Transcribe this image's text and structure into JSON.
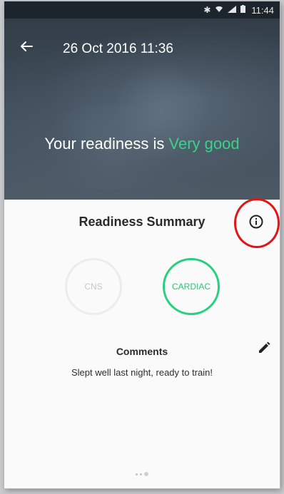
{
  "status_bar": {
    "time": "11:44",
    "icons": [
      "bluetooth-icon",
      "wifi-icon",
      "signal-icon",
      "battery-icon"
    ]
  },
  "header": {
    "title": "26 Oct 2016 11:36",
    "back_icon": "arrow-left-icon"
  },
  "hero": {
    "readiness_prefix": "Your readiness is",
    "readiness_value": "Very good",
    "accent_color": "#39d28a"
  },
  "summary": {
    "title": "Readiness Summary",
    "info_icon": "info-icon"
  },
  "indicators": {
    "cns_label": "CNS",
    "cardiac_label": "CARDIAC",
    "cardiac_color": "#27d07e"
  },
  "comments": {
    "title": "Comments",
    "text": "Slept well last night, ready to train!",
    "edit_icon": "pencil-icon"
  },
  "pager": {
    "count": 2,
    "active_index": 1
  }
}
